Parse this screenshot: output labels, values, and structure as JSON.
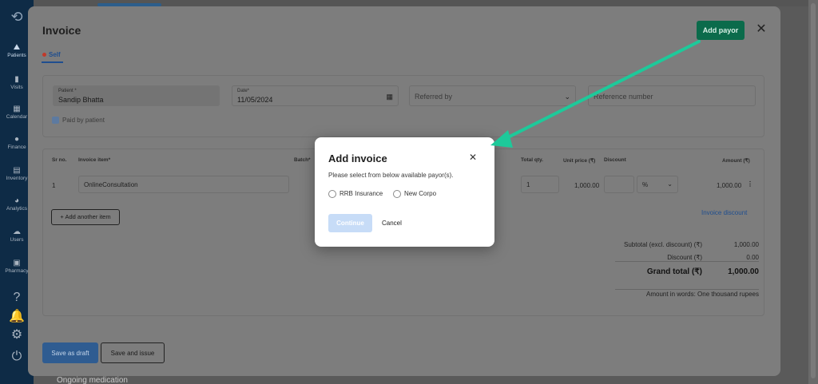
{
  "sidebar": {
    "items": [
      {
        "label": "Patients",
        "icon": "⛰"
      },
      {
        "label": "Visits",
        "icon": "▮"
      },
      {
        "label": "Calendar",
        "icon": "▦"
      },
      {
        "label": "Finance",
        "icon": "●"
      },
      {
        "label": "Inventory",
        "icon": "▤"
      },
      {
        "label": "Analytics",
        "icon": "◕"
      },
      {
        "label": "Users",
        "icon": "☁"
      },
      {
        "label": "Pharmacy",
        "icon": "▣"
      }
    ],
    "bottom_icons": [
      "?",
      "🔔",
      "⚙",
      "⏻"
    ]
  },
  "background": {
    "partial_text": "Ongoing medication"
  },
  "panel": {
    "title": "Invoice",
    "add_payor_label": "Add payor",
    "tab_self": "Self",
    "patient": {
      "label": "Patient *",
      "value": "Sandip Bhatta"
    },
    "date": {
      "label": "Date*",
      "value": "11/05/2024"
    },
    "referred_by": {
      "placeholder": "Referred by"
    },
    "reference_number": {
      "placeholder": "Reference number"
    },
    "paid_by_patient": "Paid by patient",
    "table": {
      "headers": {
        "sr_no": "Sr no.",
        "invoice_item": "Invoice item*",
        "batch": "Batch*",
        "total_qty": "Total qty.",
        "unit_price": "Unit price (₹)",
        "discount": "Discount",
        "amount": "Amount (₹)"
      },
      "rows": [
        {
          "sr_no": "1",
          "item": "OnlineConsultation",
          "qty": "1",
          "unit_price": "1,000.00",
          "discount": "",
          "discount_type": "%",
          "amount": "1,000.00"
        }
      ]
    },
    "add_item_label": "Add another item",
    "invoice_discount_label": "Invoice discount",
    "totals": {
      "subtotal_label": "Subtotal (excl. discount) (₹)",
      "subtotal_value": "1,000.00",
      "discount_label": "Discount (₹)",
      "discount_value": "0.00",
      "grand_label": "Grand total (₹)",
      "grand_value": "1,000.00",
      "words": "Amount in words: One thousand rupees"
    },
    "save_draft_label": "Save as draft",
    "save_issue_label": "Save and issue"
  },
  "modal": {
    "title": "Add invoice",
    "description": "Please select from below available payor(s).",
    "options": [
      "RRB Insurance",
      "New Corpo"
    ],
    "continue_label": "Continue",
    "cancel_label": "Cancel"
  },
  "colors": {
    "accent_green": "#0b6b4b",
    "arrow": "#1ec99a",
    "primary_blue": "#2f5c91",
    "continue_disabled": "#c7dcf7"
  }
}
